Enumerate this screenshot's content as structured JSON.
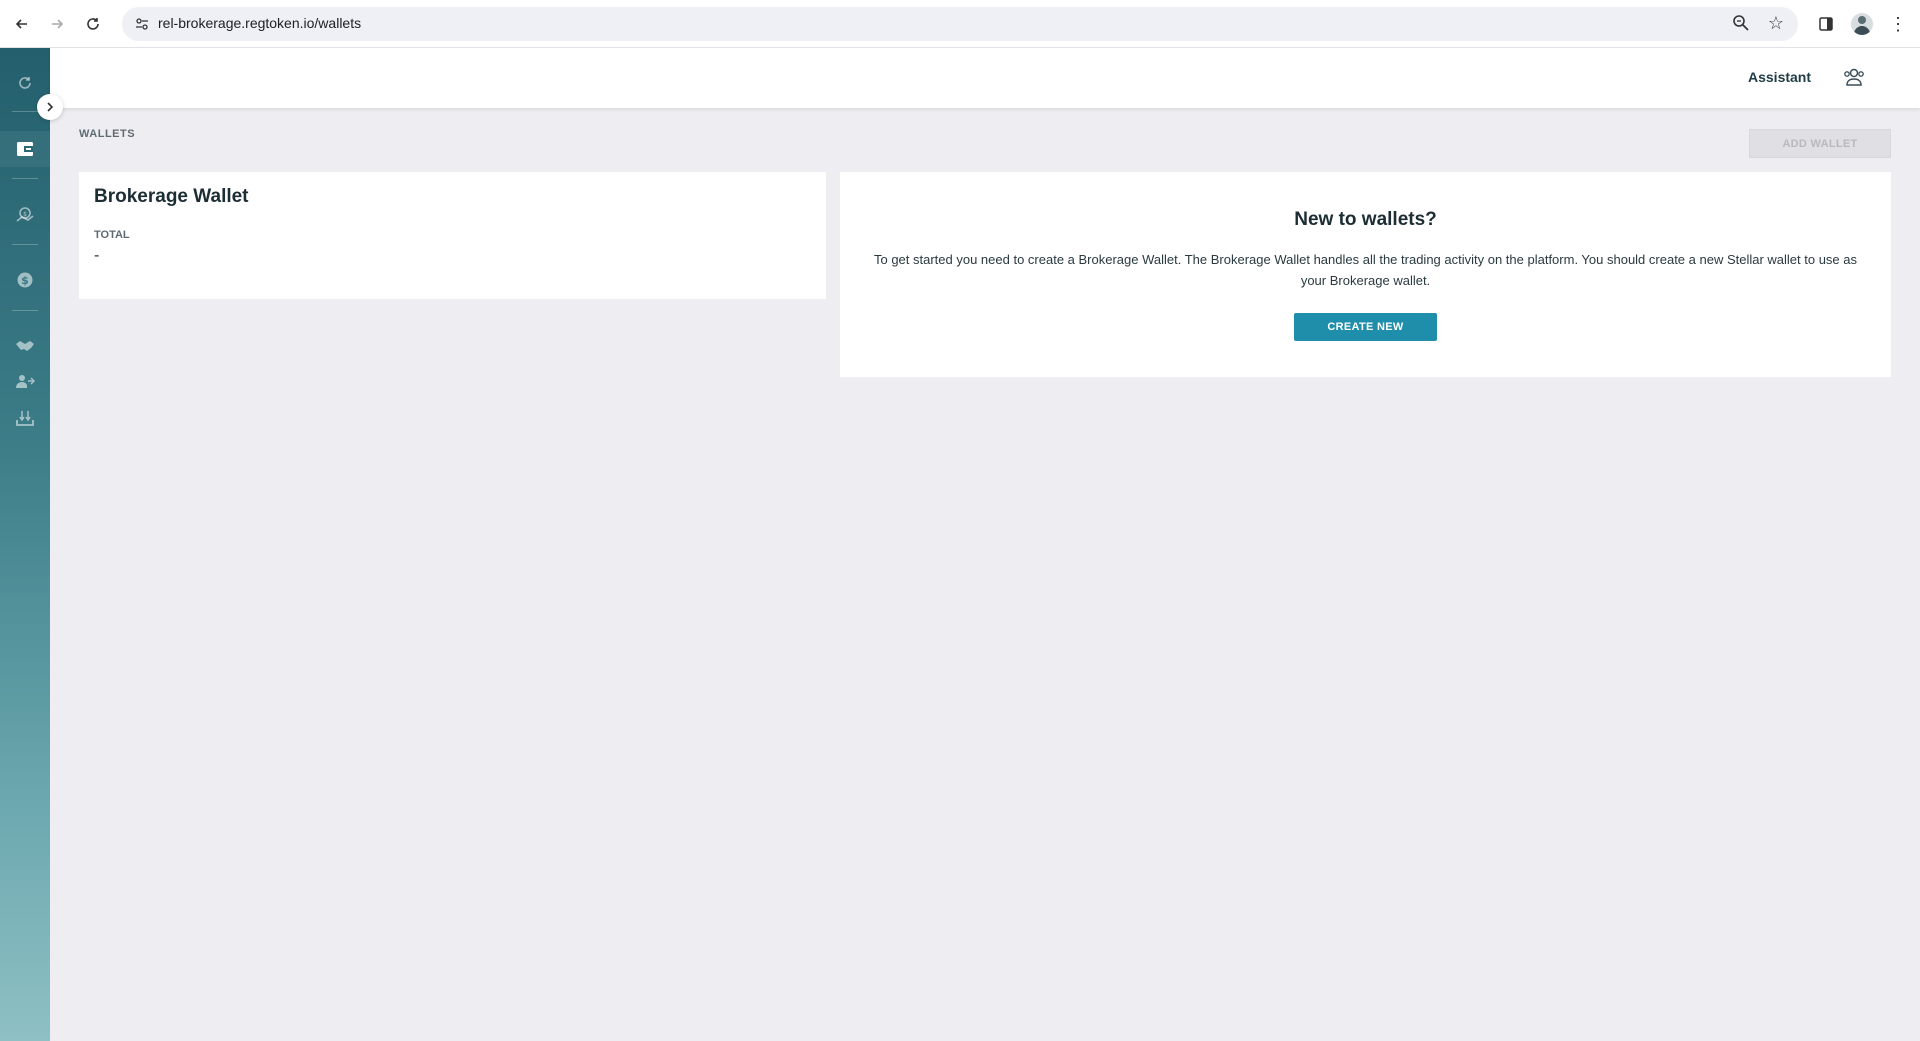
{
  "browser": {
    "url": "rel-brokerage.regtoken.io/wallets"
  },
  "header": {
    "assistant_label": "Assistant"
  },
  "page": {
    "title": "WALLETS",
    "add_wallet_label": "ADD WALLET"
  },
  "wallet_card": {
    "name": "Brokerage Wallet",
    "total_label": "TOTAL",
    "total_value": "-"
  },
  "intro_card": {
    "title": "New to wallets?",
    "text": "To get started you need to create a Brokerage Wallet. The Brokerage Wallet handles all the trading activity on the platform. You should create a new Stellar wallet to use as your Brokerage wallet.",
    "create_label": "CREATE NEW"
  },
  "colors": {
    "accent": "#1e8eab",
    "sidebar_top": "#235f6c",
    "sidebar_bottom": "#8ec0c4",
    "text_dark": "#1c2d34"
  },
  "sidebar": {
    "items": [
      {
        "icon": "refresh-icon"
      },
      {
        "icon": "wallet-icon"
      },
      {
        "icon": "investor-icon"
      },
      {
        "icon": "dollar-icon"
      },
      {
        "icon": "handshake-icon"
      },
      {
        "icon": "user-transfer-icon"
      },
      {
        "icon": "download-tray-icon"
      }
    ]
  }
}
